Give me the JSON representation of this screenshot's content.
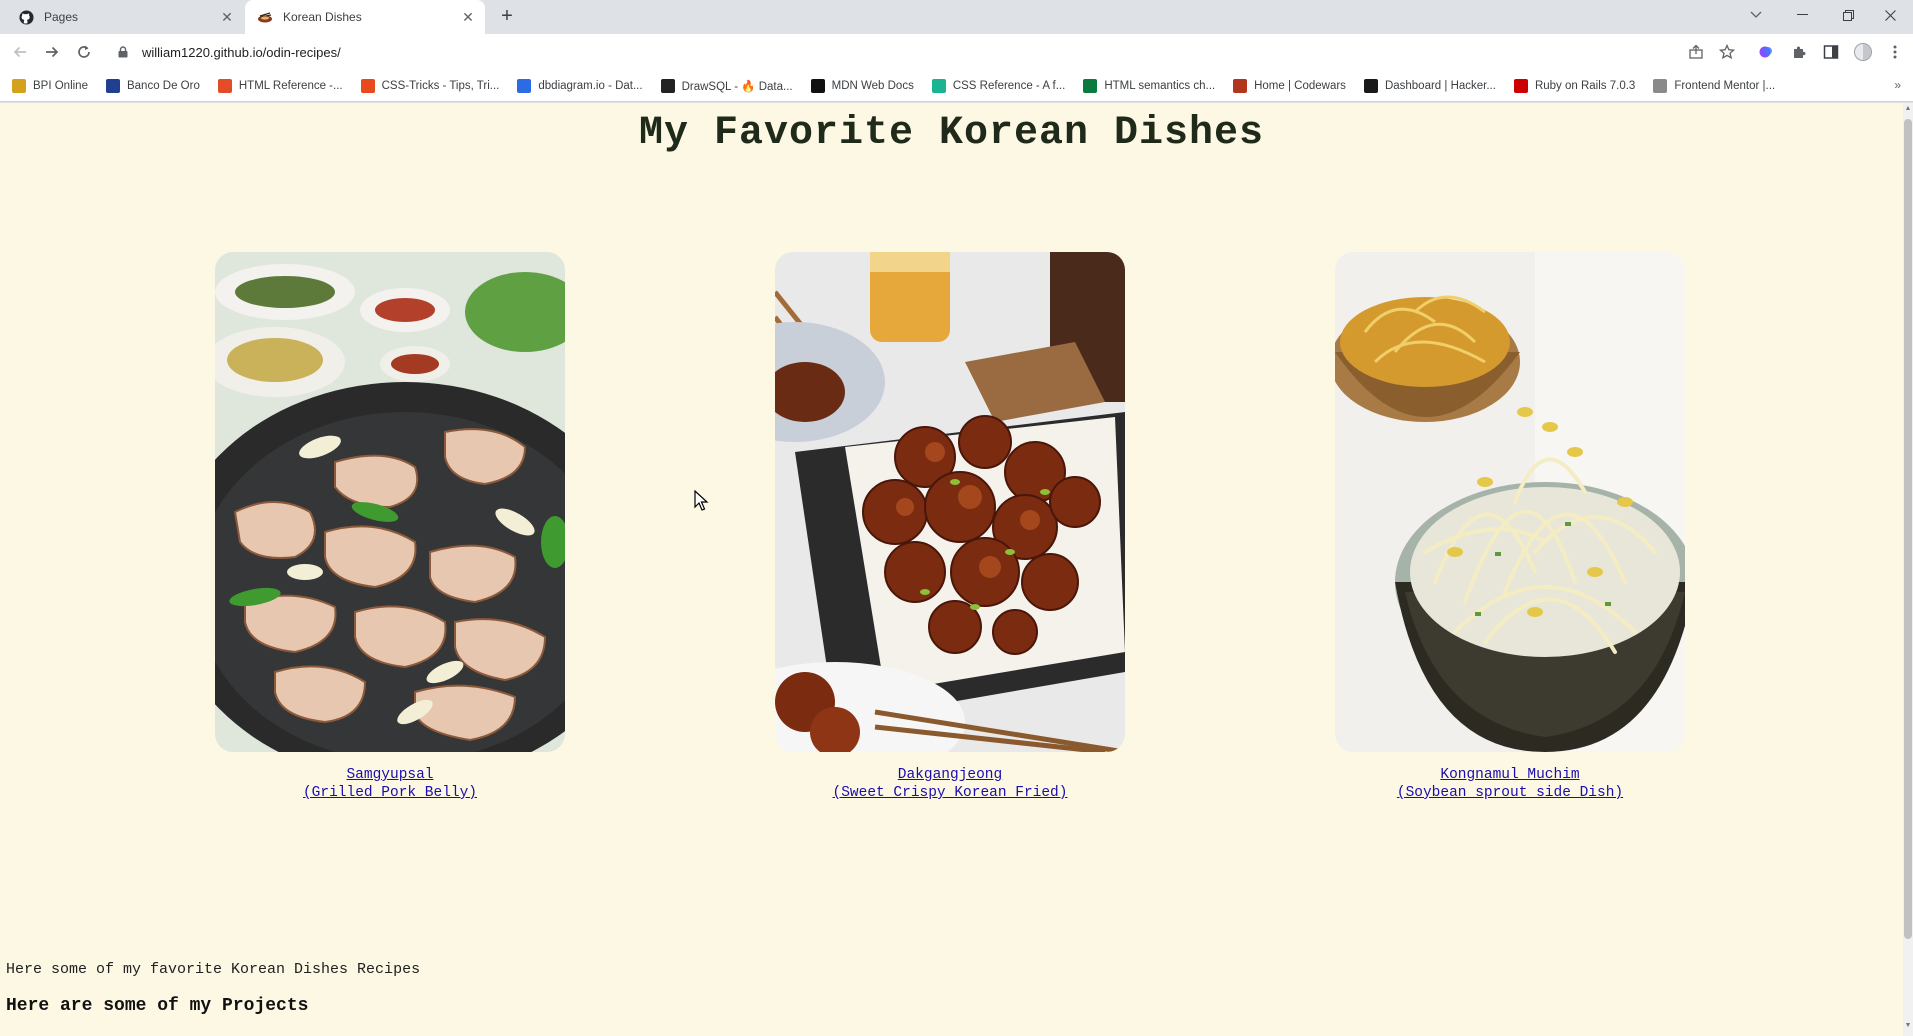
{
  "browser": {
    "tabs": [
      {
        "title": "Pages",
        "favicon": "github-icon"
      },
      {
        "title": "Korean Dishes",
        "favicon": "dish-icon"
      }
    ],
    "new_tab": "+",
    "url": "william1220.github.io/odin-recipes/",
    "bookmarks": [
      {
        "label": "BPI Online",
        "color": "#d4a21a"
      },
      {
        "label": "Banco De Oro",
        "color": "#1f3f91"
      },
      {
        "label": "HTML Reference -...",
        "color": "#e34c26"
      },
      {
        "label": "CSS-Tricks - Tips, Tri...",
        "color": "#e8491d"
      },
      {
        "label": "dbdiagram.io - Dat...",
        "color": "#2b6be6"
      },
      {
        "label": "DrawSQL - 🔥 Data...",
        "color": "#222222"
      },
      {
        "label": "MDN Web Docs",
        "color": "#111111"
      },
      {
        "label": "CSS Reference - A f...",
        "color": "#1ab394"
      },
      {
        "label": "HTML semantics ch...",
        "color": "#0b7a3e"
      },
      {
        "label": "Home | Codewars",
        "color": "#b1361e"
      },
      {
        "label": "Dashboard | Hacker...",
        "color": "#1a1a1a"
      },
      {
        "label": "Ruby on Rails 7.0.3",
        "color": "#cc0000"
      },
      {
        "label": "Frontend Mentor |...",
        "color": "#8a8a8a"
      }
    ],
    "more_bookmarks": "»"
  },
  "page": {
    "title": "My Favorite Korean Dishes",
    "dishes": [
      {
        "name": "Samgyupsal",
        "subtitle": "(Grilled Pork Belly)"
      },
      {
        "name": "Dakgangjeong",
        "subtitle": "(Sweet Crispy Korean Fried)"
      },
      {
        "name": "Kongnamul Muchim",
        "subtitle": "(Soybean sprout side Dish)"
      }
    ],
    "intro": "Here some of my favorite Korean Dishes Recipes",
    "projects_heading": "Here are some of my Projects"
  }
}
